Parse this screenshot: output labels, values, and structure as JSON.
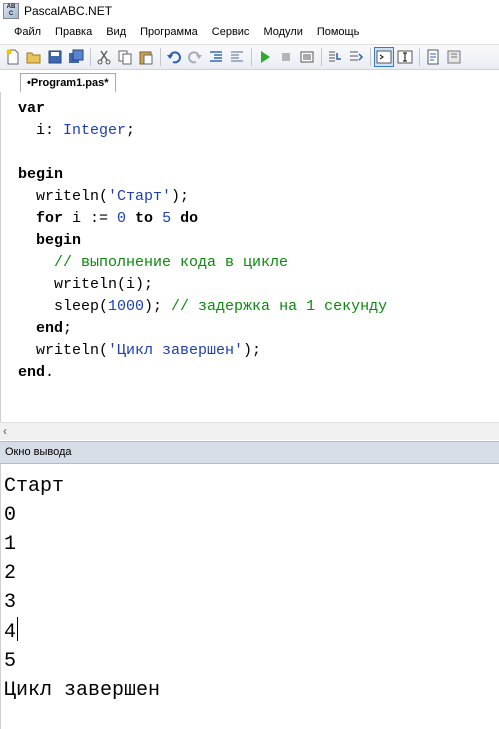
{
  "window": {
    "title": "PascalABC.NET"
  },
  "menu": [
    "Файл",
    "Правка",
    "Вид",
    "Программа",
    "Сервис",
    "Модули",
    "Помощь"
  ],
  "toolbar": {
    "buttons": [
      "new-file-icon",
      "open-icon",
      "save-icon",
      "save-all-icon",
      "cut-icon",
      "copy-icon",
      "paste-icon",
      "undo-icon",
      "redo-icon",
      "indent-icon",
      "outdent-icon",
      "run-icon",
      "stop-icon",
      "compile-icon",
      "step-into-icon",
      "step-over-icon",
      "console-output-icon",
      "text-output-icon",
      "settings-icon",
      "help-icon"
    ]
  },
  "tab": {
    "label": "•Program1.pas*"
  },
  "code": {
    "l1_kw": "var",
    "l2_a": "  i: ",
    "l2_type": "Integer",
    "l2_b": ";",
    "l4_kw": "begin",
    "l5_a": "  writeln(",
    "l5_str": "'Старт'",
    "l5_b": ");",
    "l6_for": "  for",
    "l6_a": " i := ",
    "l6_n1": "0",
    "l6_to": " to",
    "l6_sp": " ",
    "l6_n2": "5",
    "l6_do": " do",
    "l7_kw": "  begin",
    "l8_cm": "    // выполнение кода в цикле",
    "l9": "    writeln(i);",
    "l10_a": "    sleep(",
    "l10_n": "1000",
    "l10_b": "); ",
    "l10_cm": "// задержка на 1 секунду",
    "l11_kw": "  end",
    "l11_b": ";",
    "l12_a": "  writeln(",
    "l12_str": "'Цикл завершен'",
    "l12_b": ");",
    "l13_kw": "end",
    "l13_b": "."
  },
  "output": {
    "header": "Окно вывода",
    "lines": [
      "Старт",
      "0",
      "1",
      "2",
      "3",
      "4",
      "5",
      "Цикл завершен"
    ]
  },
  "colors": {
    "keyword": "#000000",
    "type": "#1d3eb4",
    "string": "#1d3eb4",
    "comment": "#0a8a0a",
    "output_header_bg": "#d7dde6"
  }
}
